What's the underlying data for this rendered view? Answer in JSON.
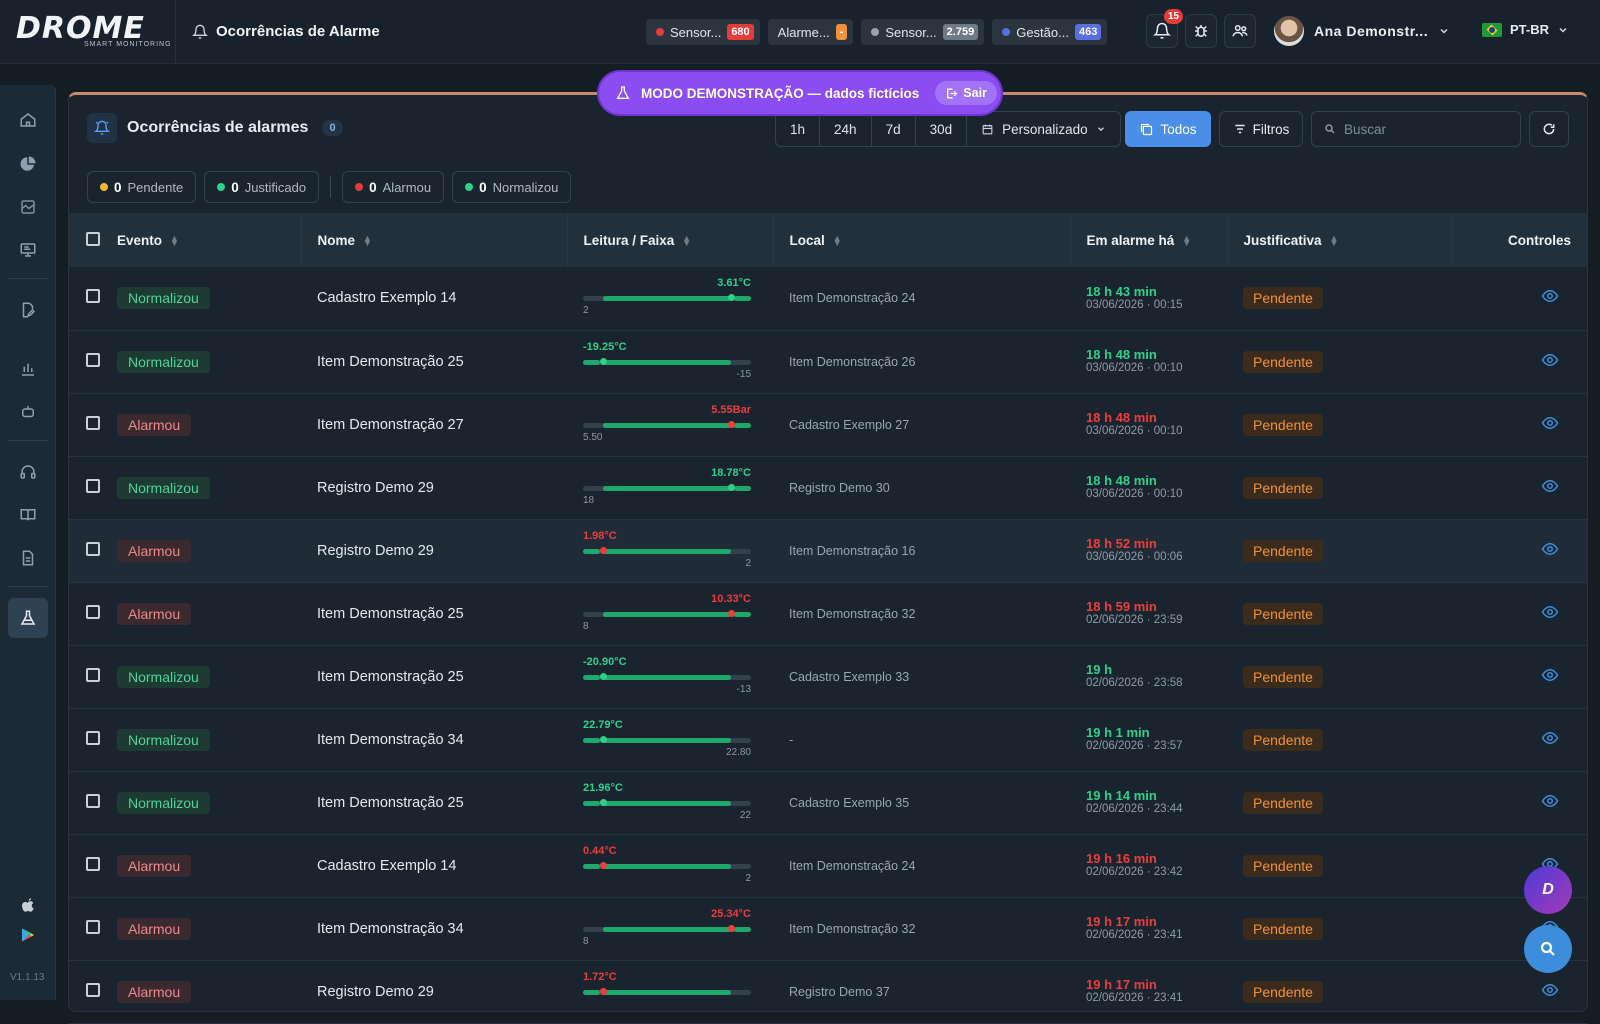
{
  "app": {
    "brand": "DROME",
    "brand_sub": "SMART MONITORING",
    "page_title": "Ocorrências de Alarme",
    "version": "V1.1.13"
  },
  "header": {
    "chips": [
      {
        "label": "Sensor...",
        "count": "680",
        "dot_color": "#e43b3b",
        "count_bg": "#e43b3b"
      },
      {
        "label": "Alarme...",
        "count": "-",
        "dot_color": "",
        "count_bg": "#f0923a"
      },
      {
        "label": "Sensor...",
        "count": "2.759",
        "dot_color": "#9aa4ae",
        "count_bg": "#6e7a86"
      },
      {
        "label": "Gestão...",
        "count": "463",
        "dot_color": "#5b6ee0",
        "count_bg": "#5b6ee0"
      }
    ],
    "notifications": "15",
    "user_name": "Ana Demonstr...",
    "language": "PT-BR"
  },
  "demo_banner": {
    "text": "MODO DEMONSTRAÇÃO — dados fictícios",
    "exit_label": "Sair"
  },
  "panel": {
    "title": "Ocorrências de alarmes",
    "count": "0",
    "ranges": [
      "1h",
      "24h",
      "7d",
      "30d"
    ],
    "custom_label": "Personalizado",
    "todos_label": "Todos",
    "filters_label": "Filtros",
    "search_placeholder": "Buscar",
    "stats": [
      {
        "count": "0",
        "label": "Pendente",
        "color": "#f2b92f"
      },
      {
        "count": "0",
        "label": "Justificado",
        "color": "#2fd08a"
      },
      {
        "count": "0",
        "label": "Alarmou",
        "color": "#e43b3b"
      },
      {
        "count": "0",
        "label": "Normalizou",
        "color": "#2fd08a"
      }
    ]
  },
  "table": {
    "columns": [
      "Evento",
      "Nome",
      "Leitura / Faixa",
      "Local",
      "Em alarme há",
      "Justificativa",
      "Controles"
    ],
    "rows": [
      {
        "event": "Normalizou",
        "type": "norm",
        "name": "Cadastro Exemplo 14",
        "reading": "3.61°C",
        "limit": "2",
        "reading_pos": 0.88,
        "local": "Item Demonstração 24",
        "duration": "18 h 43 min",
        "datetime": "03/06/2026 · 00:15",
        "justification": "Pendente"
      },
      {
        "event": "Normalizou",
        "type": "norm",
        "name": "Item Demonstração 25",
        "reading": "-19.25°C",
        "limit": "-15",
        "reading_pos": 0.12,
        "local": "Item Demonstração 26",
        "duration": "18 h 48 min",
        "datetime": "03/06/2026 · 00:10",
        "justification": "Pendente"
      },
      {
        "event": "Alarmou",
        "type": "alarm",
        "name": "Item Demonstração 27",
        "reading": "5.55Bar",
        "limit": "5.50",
        "reading_pos": 0.88,
        "local": "Cadastro Exemplo 27",
        "duration": "18 h 48 min",
        "datetime": "03/06/2026 · 00:10",
        "justification": "Pendente"
      },
      {
        "event": "Normalizou",
        "type": "norm",
        "name": "Registro Demo 29",
        "reading": "18.78°C",
        "limit": "18",
        "reading_pos": 0.88,
        "local": "Registro Demo 30",
        "duration": "18 h 48 min",
        "datetime": "03/06/2026 · 00:10",
        "justification": "Pendente"
      },
      {
        "event": "Alarmou",
        "type": "alarm",
        "name": "Registro Demo 29",
        "reading": "1.98°C",
        "limit": "2",
        "reading_pos": 0.12,
        "local": "Item Demonstração 16",
        "duration": "18 h 52 min",
        "datetime": "03/06/2026 · 00:06",
        "justification": "Pendente"
      },
      {
        "event": "Alarmou",
        "type": "alarm",
        "name": "Item Demonstração 25",
        "reading": "10.33°C",
        "limit": "8",
        "reading_pos": 0.88,
        "local": "Item Demonstração 32",
        "duration": "18 h 59 min",
        "datetime": "02/06/2026 · 23:59",
        "justification": "Pendente"
      },
      {
        "event": "Normalizou",
        "type": "norm",
        "name": "Item Demonstração 25",
        "reading": "-20.90°C",
        "limit": "-13",
        "reading_pos": 0.12,
        "local": "Cadastro Exemplo 33",
        "duration": "19 h",
        "datetime": "02/06/2026 · 23:58",
        "justification": "Pendente"
      },
      {
        "event": "Normalizou",
        "type": "norm",
        "name": "Item Demonstração 34",
        "reading": "22.79°C",
        "limit": "22.80",
        "reading_pos": 0.12,
        "local": "-",
        "duration": "19 h 1 min",
        "datetime": "02/06/2026 · 23:57",
        "justification": "Pendente"
      },
      {
        "event": "Normalizou",
        "type": "norm",
        "name": "Item Demonstração 25",
        "reading": "21.96°C",
        "limit": "22",
        "reading_pos": 0.12,
        "local": "Cadastro Exemplo 35",
        "duration": "19 h 14 min",
        "datetime": "02/06/2026 · 23:44",
        "justification": "Pendente"
      },
      {
        "event": "Alarmou",
        "type": "alarm",
        "name": "Cadastro Exemplo 14",
        "reading": "0.44°C",
        "limit": "2",
        "reading_pos": 0.12,
        "local": "Item Demonstração 24",
        "duration": "19 h 16 min",
        "datetime": "02/06/2026 · 23:42",
        "justification": "Pendente"
      },
      {
        "event": "Alarmou",
        "type": "alarm",
        "name": "Item Demonstração 34",
        "reading": "25.34°C",
        "limit": "8",
        "reading_pos": 0.88,
        "local": "Item Demonstração 32",
        "duration": "19 h 17 min",
        "datetime": "02/06/2026 · 23:41",
        "justification": "Pendente"
      },
      {
        "event": "Alarmou",
        "type": "alarm",
        "name": "Registro Demo 29",
        "reading": "1.72°C",
        "limit": "",
        "reading_pos": 0.12,
        "local": "Registro Demo 37",
        "duration": "19 h 17 min",
        "datetime": "02/06/2026 · 23:41",
        "justification": "Pendente"
      }
    ]
  },
  "colors": {
    "accent": "#4a8ee8",
    "normal": "#2fd08a",
    "alarm": "#ec3e3e",
    "pending": "#f0923a",
    "demo": "#8b4cf0"
  }
}
